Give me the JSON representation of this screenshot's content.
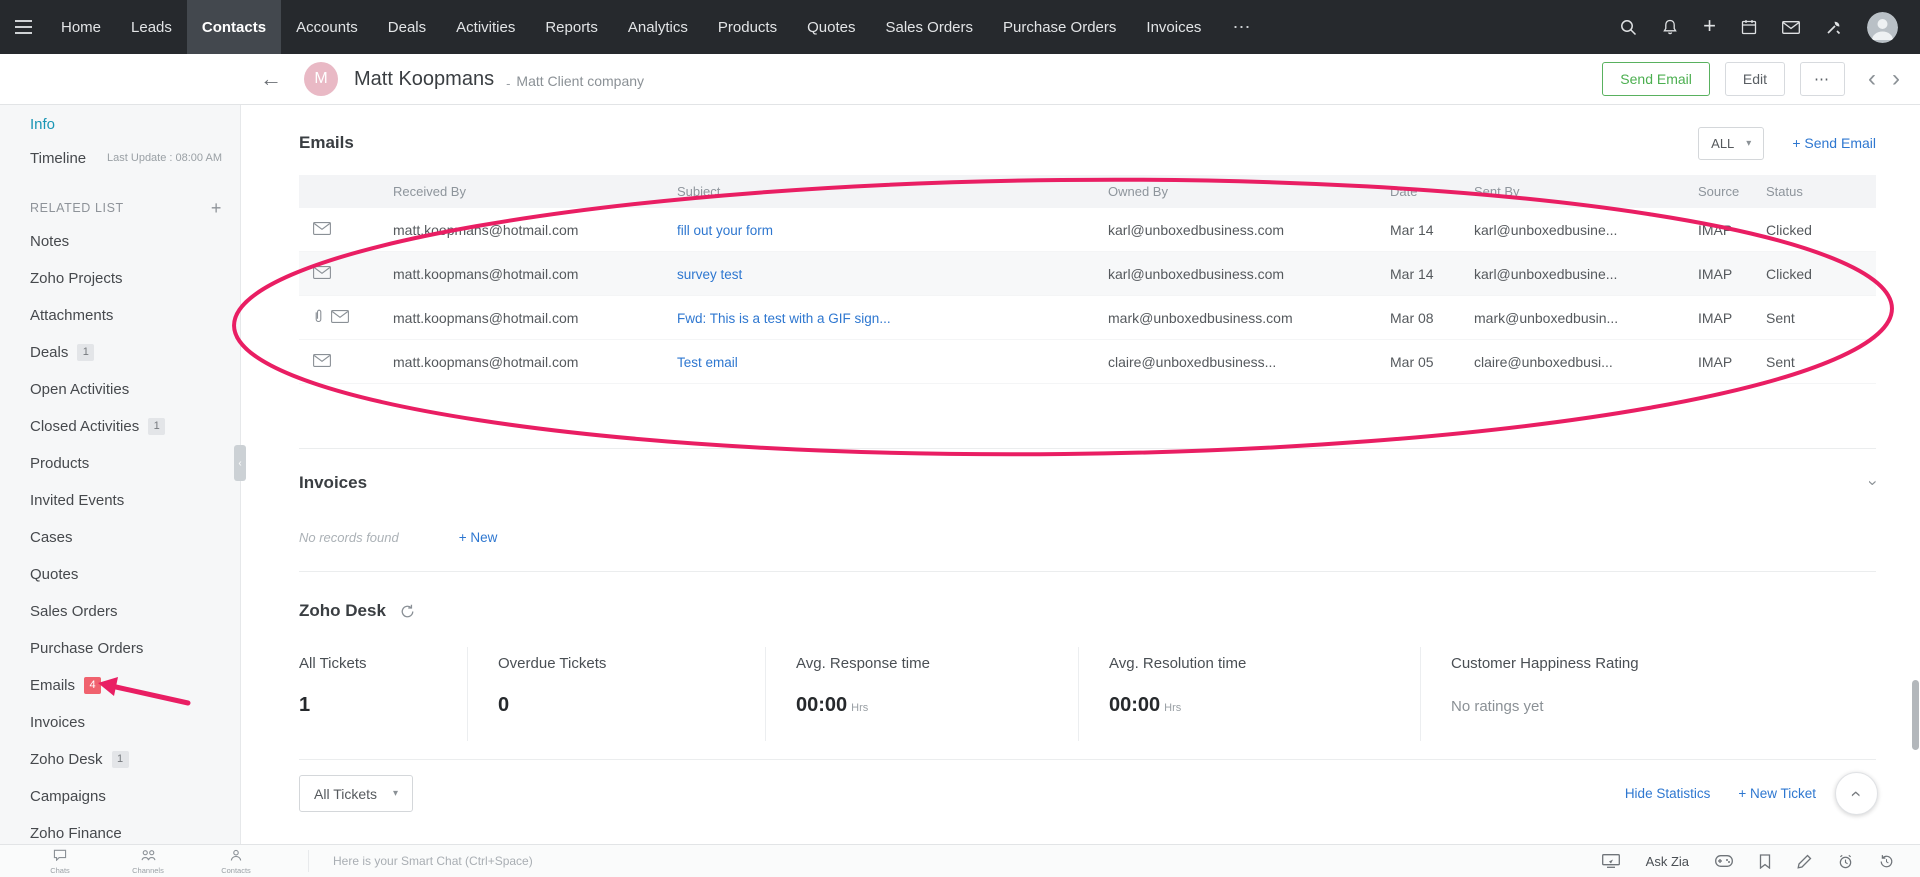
{
  "colors": {
    "nav_bg": "#26292d",
    "accent_green": "#4caf50",
    "link_blue": "#2e77d0",
    "active_teal": "#1a96b5",
    "badge_red": "#f0626e",
    "annotation_pink": "#e91e63"
  },
  "topnav": {
    "items": [
      {
        "label": "Home"
      },
      {
        "label": "Leads"
      },
      {
        "label": "Contacts",
        "active": true
      },
      {
        "label": "Accounts"
      },
      {
        "label": "Deals"
      },
      {
        "label": "Activities"
      },
      {
        "label": "Reports"
      },
      {
        "label": "Analytics"
      },
      {
        "label": "Products"
      },
      {
        "label": "Quotes"
      },
      {
        "label": "Sales Orders"
      },
      {
        "label": "Purchase Orders"
      },
      {
        "label": "Invoices"
      }
    ],
    "more_icon": "⋯",
    "add_icon": "+",
    "icons": {
      "search": "magnifier",
      "notifications": "bell",
      "add": "plus",
      "calendar": "calendar",
      "mail": "envelope",
      "tools": "wrench",
      "avatar": "user-photo"
    }
  },
  "record_header": {
    "back_icon": "←",
    "avatar_initial": "M",
    "title": "Matt Koopmans",
    "company_separator": "-",
    "company": "Matt Client company",
    "send_email_label": "Send Email",
    "edit_label": "Edit",
    "more_label": "⋯",
    "prev_icon": "‹",
    "next_icon": "›"
  },
  "sidebar": {
    "info_label": "Info",
    "timeline_label": "Timeline",
    "timeline_meta": "Last Update : 08:00 AM",
    "related_list_label": "RELATED LIST",
    "add_icon": "+",
    "collapse_icon": "‹",
    "items": [
      {
        "label": "Notes"
      },
      {
        "label": "Zoho Projects"
      },
      {
        "label": "Attachments"
      },
      {
        "label": "Deals",
        "badge": "1"
      },
      {
        "label": "Open Activities"
      },
      {
        "label": "Closed Activities",
        "badge": "1"
      },
      {
        "label": "Products"
      },
      {
        "label": "Invited Events"
      },
      {
        "label": "Cases"
      },
      {
        "label": "Quotes"
      },
      {
        "label": "Sales Orders"
      },
      {
        "label": "Purchase Orders"
      },
      {
        "label": "Emails",
        "badge": "4"
      },
      {
        "label": "Invoices"
      },
      {
        "label": "Zoho Desk",
        "badge": "1"
      },
      {
        "label": "Campaigns"
      },
      {
        "label": "Zoho Finance"
      }
    ]
  },
  "emails_section": {
    "title": "Emails",
    "filter_value": "ALL",
    "filter_caret": "▾",
    "send_email_label": "+ Send Email",
    "columns": {
      "received_by": "Received By",
      "subject": "Subject",
      "owned_by": "Owned By",
      "date": "Date",
      "sent_by": "Sent By",
      "source": "Source",
      "status": "Status"
    },
    "rows": [
      {
        "received_by": "matt.koopmans@hotmail.com",
        "subject": "fill out your form",
        "owned_by": "karl@unboxedbusiness.com",
        "date": "Mar 14",
        "sent_by": "karl@unboxedbusine...",
        "source": "IMAP",
        "status": "Clicked",
        "attachment": false
      },
      {
        "received_by": "matt.koopmans@hotmail.com",
        "subject": "survey test",
        "owned_by": "karl@unboxedbusiness.com",
        "date": "Mar 14",
        "sent_by": "karl@unboxedbusine...",
        "source": "IMAP",
        "status": "Clicked",
        "attachment": false
      },
      {
        "received_by": "matt.koopmans@hotmail.com",
        "subject": "Fwd: This is a test with a GIF sign...",
        "owned_by": "mark@unboxedbusiness.com",
        "date": "Mar 08",
        "sent_by": "mark@unboxedbusin...",
        "source": "IMAP",
        "status": "Sent",
        "attachment": true
      },
      {
        "received_by": "matt.koopmans@hotmail.com",
        "subject": "Test email",
        "owned_by": "claire@unboxedbusiness...",
        "date": "Mar 05",
        "sent_by": "claire@unboxedbusi...",
        "source": "IMAP",
        "status": "Sent",
        "attachment": false
      }
    ]
  },
  "invoices_section": {
    "title": "Invoices",
    "collapse_icon": "›",
    "empty_text": "No records found",
    "new_label": "+ New"
  },
  "desk_section": {
    "title": "Zoho Desk",
    "stats": [
      {
        "label": "All Tickets",
        "value": "1"
      },
      {
        "label": "Overdue Tickets",
        "value": "0"
      },
      {
        "label": "Avg. Response time",
        "value": "00:00",
        "unit": "Hrs"
      },
      {
        "label": "Avg. Resolution time",
        "value": "00:00",
        "unit": "Hrs"
      },
      {
        "label": "Customer Happiness Rating",
        "value": "No ratings yet"
      }
    ],
    "filter_value": "All Tickets",
    "filter_caret": "▾",
    "hide_statistics_label": "Hide Statistics",
    "new_ticket_label": "+ New Ticket",
    "scroll_top_icon": "›"
  },
  "footer": {
    "apps": [
      {
        "label": "Chats"
      },
      {
        "label": "Channels"
      },
      {
        "label": "Contacts"
      }
    ],
    "chat_placeholder": "Here is your Smart Chat (Ctrl+Space)",
    "ask_zia_label": "Ask Zia"
  }
}
